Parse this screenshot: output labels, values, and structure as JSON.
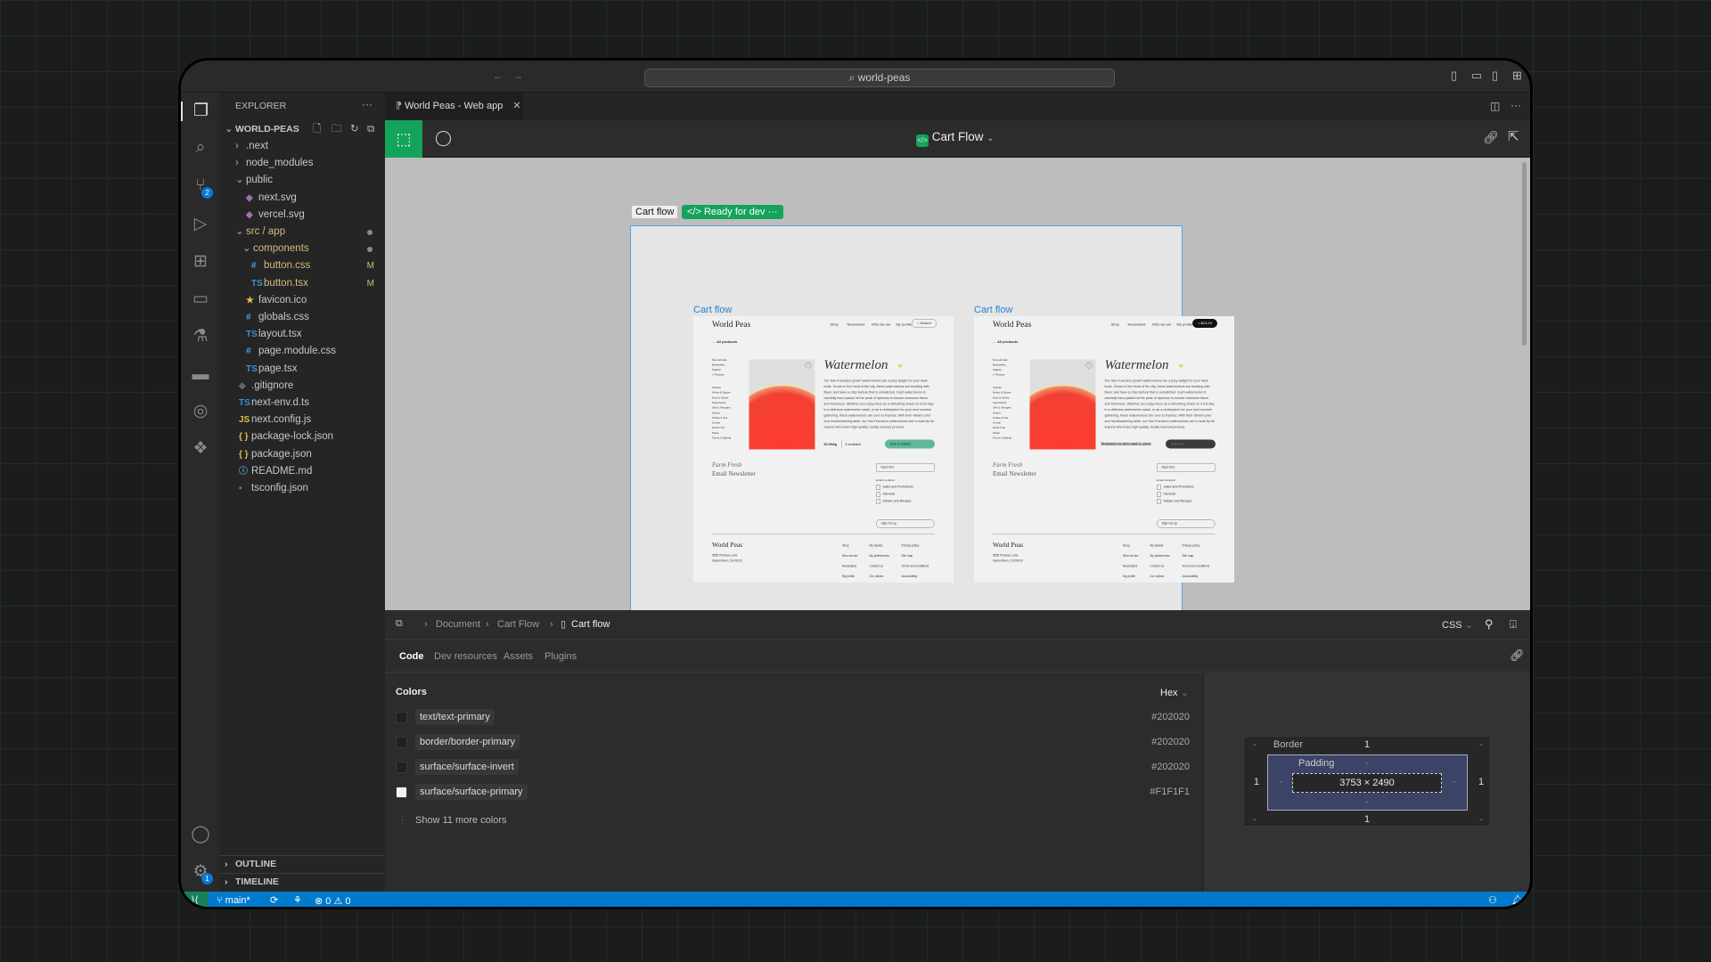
{
  "titlebar": {
    "search": "world-peas"
  },
  "activity_bar": {
    "source_control_badge": "2",
    "settings_badge": "1"
  },
  "explorer": {
    "header": "EXPLORER",
    "root": "WORLD-PEAS",
    "items": [
      {
        "label": ".next",
        "type": "folder",
        "depth": 1,
        "open": false
      },
      {
        "label": "node_modules",
        "type": "folder",
        "depth": 1,
        "open": false
      },
      {
        "label": "public",
        "type": "folder",
        "depth": 1,
        "open": true
      },
      {
        "label": "next.svg",
        "type": "svg",
        "depth": 2
      },
      {
        "label": "vercel.svg",
        "type": "svg",
        "depth": 2
      },
      {
        "label": "src / app",
        "type": "folder",
        "depth": 1,
        "open": true,
        "modified_dot": true
      },
      {
        "label": "components",
        "type": "folder",
        "depth": 2,
        "open": true,
        "modified_dot": true
      },
      {
        "label": "button.css",
        "type": "css",
        "depth": 3,
        "status": "M"
      },
      {
        "label": "button.tsx",
        "type": "ts",
        "depth": 3,
        "status": "M"
      },
      {
        "label": "favicon.ico",
        "type": "star",
        "depth": 2
      },
      {
        "label": "globals.css",
        "type": "css",
        "depth": 2
      },
      {
        "label": "layout.tsx",
        "type": "ts",
        "depth": 2
      },
      {
        "label": "page.module.css",
        "type": "css",
        "depth": 2
      },
      {
        "label": "page.tsx",
        "type": "ts",
        "depth": 2
      },
      {
        "label": ".gitignore",
        "type": "git",
        "depth": 1
      },
      {
        "label": "next-env.d.ts",
        "type": "ts",
        "depth": 1
      },
      {
        "label": "next.config.js",
        "type": "js",
        "depth": 1
      },
      {
        "label": "package-lock.json",
        "type": "json",
        "depth": 1
      },
      {
        "label": "package.json",
        "type": "json",
        "depth": 1
      },
      {
        "label": "README.md",
        "type": "info",
        "depth": 1
      },
      {
        "label": "tsconfig.json",
        "type": "tsconfig",
        "depth": 1
      }
    ],
    "outline": "OUTLINE",
    "timeline": "TIMELINE"
  },
  "editor": {
    "tab": "World Peas - Web app",
    "toolbar_title": "Cart Flow",
    "canvas": {
      "frame_label": "Cart flow",
      "status_badge": "Ready for dev",
      "status_color": "#14a35a"
    }
  },
  "frames": [
    {
      "label": "Cart flow",
      "basket": "Basket",
      "basket_dark": false,
      "secondary": "6 available",
      "secondary_link": false,
      "cta": "Add to basket",
      "cta_color": "#5fb896"
    },
    {
      "label": "Cart flow",
      "basket": "$13.24",
      "basket_dark": true,
      "secondary": "Reminded me when back in stock",
      "secondary_link": true,
      "cta": "Sold out",
      "cta_color": "#3a3a3a"
    }
  ],
  "site": {
    "logo": "World Peas",
    "nav": [
      "Shop",
      "Newsstand",
      "Who we are",
      "My profile"
    ],
    "back": "← All products",
    "categories_top": [
      "New arrivals",
      "Bestsellers",
      "Staples",
      "+ Produce"
    ],
    "categories": [
      "Snacks",
      "Herbs & Spices",
      "Nuts & Seeds",
      "Superfoods",
      "Oils & Vinegars",
      "Grains",
      "Coffee & Tea",
      "Cereal",
      "Dried Fruit",
      "Pasta",
      "Flours & Baking"
    ],
    "product": {
      "title": "Watermelon",
      "price": "$3.99/kg",
      "description": "Our San Francisco-grown watermelons are a juicy delight for your taste buds. Grown in the heart of the city, these watermelons are bursting with flavor and have a crisp texture that is unmatched. Each watermelon is carefully hand-picked at the peak of ripeness to ensure maximum flavor and freshness. Whether you enjoy them as a refreshing snack on a hot day, in a delicious watermelon salad, or as a centerpiece for your next summer gathering, these watermelons are sure to impress. With their vibrant color and mouthwatering taste, our San Francisco watermelons are a must-try for anyone who loves high-quality, locally sourced produce."
    },
    "newsletter": {
      "kicker": "Farm Fresh",
      "title": "Email Newsletter",
      "input": "Input text",
      "label": "Email me about",
      "options": [
        "Sales and Promotions",
        "Harvests",
        "Articles and Recipes"
      ],
      "button": "Sign me up"
    },
    "footer": {
      "logo": "World Peas",
      "address1": "5555 Produce Lane",
      "address2": "Gardentown, CA 91910",
      "cols": [
        [
          "Shop",
          "Who we are",
          "Newsstand",
          "My profile"
        ],
        [
          "My basket",
          "My preferences",
          "Contact us",
          "Our values"
        ],
        [
          "Privacy policy",
          "Site map",
          "Terms and conditions",
          "Accessibility"
        ]
      ]
    }
  },
  "panel": {
    "breadcrumb": [
      "Document",
      "Cart Flow",
      "Cart flow"
    ],
    "lang": "CSS",
    "tabs": [
      "Code",
      "Dev resources",
      "Assets",
      "Plugins"
    ],
    "colors_title": "Colors",
    "format": "Hex",
    "colors": [
      {
        "name": "text/text-primary",
        "hex": "#202020"
      },
      {
        "name": "border/border-primary",
        "hex": "#202020"
      },
      {
        "name": "surface/surface-invert",
        "hex": "#202020"
      },
      {
        "name": "surface/surface-primary",
        "hex": "#F1F1F1"
      }
    ],
    "show_more": "Show 11 more colors",
    "box": {
      "border_label": "Border",
      "padding_label": "Padding",
      "border_top": "1",
      "border_left": "1",
      "border_right": "1",
      "border_bottom": "1",
      "size": "3753 × 2490",
      "empty": "-"
    }
  },
  "statusbar": {
    "branch": "main*",
    "errors": "0",
    "warnings": "0"
  }
}
